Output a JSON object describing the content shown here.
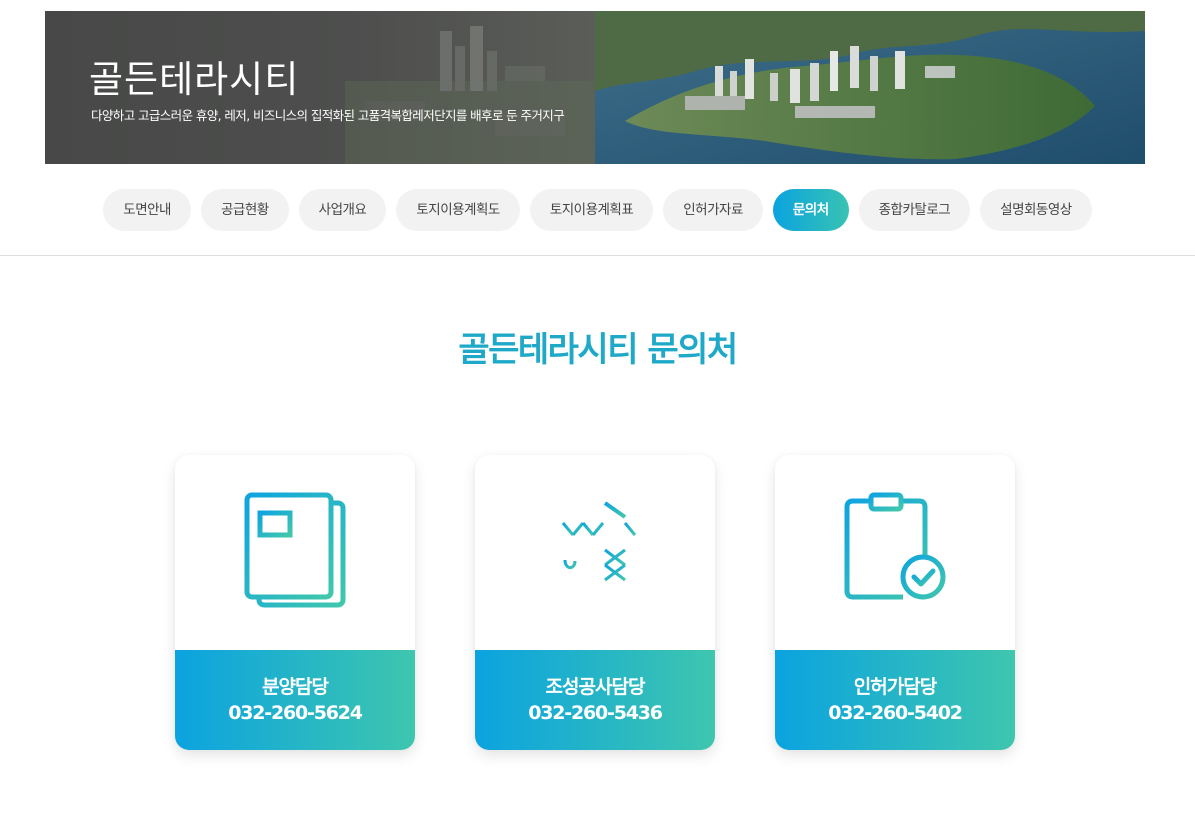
{
  "banner": {
    "title": "골든테라시티",
    "subtitle": "다양하고 고급스러운 휴양, 레저, 비즈니스의 집적화된 고품격복합레저단지를 배후로 둔 주거지구"
  },
  "tabs": [
    {
      "label": "도면안내",
      "active": false
    },
    {
      "label": "공급현황",
      "active": false
    },
    {
      "label": "사업개요",
      "active": false
    },
    {
      "label": "토지이용계획도",
      "active": false
    },
    {
      "label": "토지이용계획표",
      "active": false
    },
    {
      "label": "인허가자료",
      "active": false
    },
    {
      "label": "문의처",
      "active": true
    },
    {
      "label": "종합카탈로그",
      "active": false
    },
    {
      "label": "설명회동영상",
      "active": false
    }
  ],
  "main": {
    "title": "골든테라시티 문의처"
  },
  "contacts": [
    {
      "department": "분양담당",
      "phone": "032-260-5624",
      "icon": "document-icon"
    },
    {
      "department": "조성공사담당",
      "phone": "032-260-5436",
      "icon": "crane-icon"
    },
    {
      "department": "인허가담당",
      "phone": "032-260-5402",
      "icon": "clipboard-check-icon"
    }
  ],
  "colors": {
    "accent_start": "#0ba3e0",
    "accent_end": "#3ec6ae",
    "title": "#1fa9c8"
  }
}
